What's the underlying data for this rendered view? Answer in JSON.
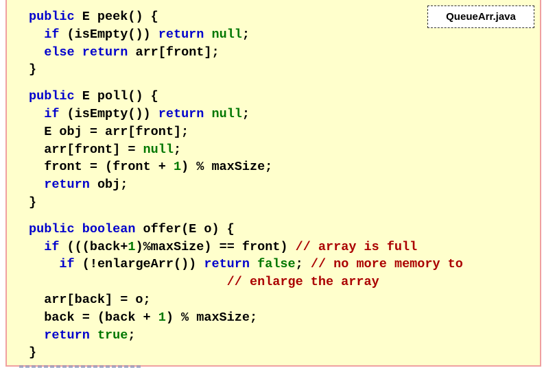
{
  "file_tag": "QueueArr.java",
  "code": {
    "peek": {
      "l1": [
        "public",
        " E peek() {"
      ],
      "l2": [
        "  ",
        "if",
        " (isEmpty()) ",
        "return",
        " ",
        "null",
        ";"
      ],
      "l3": [
        "  ",
        "else",
        " ",
        "return",
        " arr[front];"
      ],
      "l4": "}"
    },
    "poll": {
      "l1": [
        "public",
        " E poll() {"
      ],
      "l2": [
        "  ",
        "if",
        " (isEmpty()) ",
        "return",
        " ",
        "null",
        ";"
      ],
      "l3": "  E obj = arr[front];",
      "l4": [
        "  arr[front] = ",
        "null",
        ";"
      ],
      "l5": [
        "  front = (front + ",
        "1",
        ") % maxSize;"
      ],
      "l6": [
        "  ",
        "return",
        " obj;"
      ],
      "l7": "}"
    },
    "offer": {
      "l1": [
        "public",
        " ",
        "boolean",
        " offer(E o) {"
      ],
      "l2": [
        "  ",
        "if",
        " (((back+",
        "1",
        ")%maxSize) == front) ",
        "// array is full"
      ],
      "l3": [
        "    ",
        "if",
        " (!enlargeArr()) ",
        "return",
        " ",
        "false",
        "; ",
        "// no more memory to"
      ],
      "l4": [
        "                          ",
        "// enlarge the array"
      ],
      "l5": "  arr[back] = o;",
      "l6": [
        "  back = (back + ",
        "1",
        ") % maxSize;"
      ],
      "l7": [
        "  ",
        "return",
        " ",
        "true",
        ";"
      ],
      "l8": "}"
    }
  },
  "colors": {
    "panel_bg": "#ffffcc",
    "panel_border": "#f0a0a0",
    "keyword": "#0000cc",
    "literal": "#007700",
    "comment": "#aa0000"
  }
}
